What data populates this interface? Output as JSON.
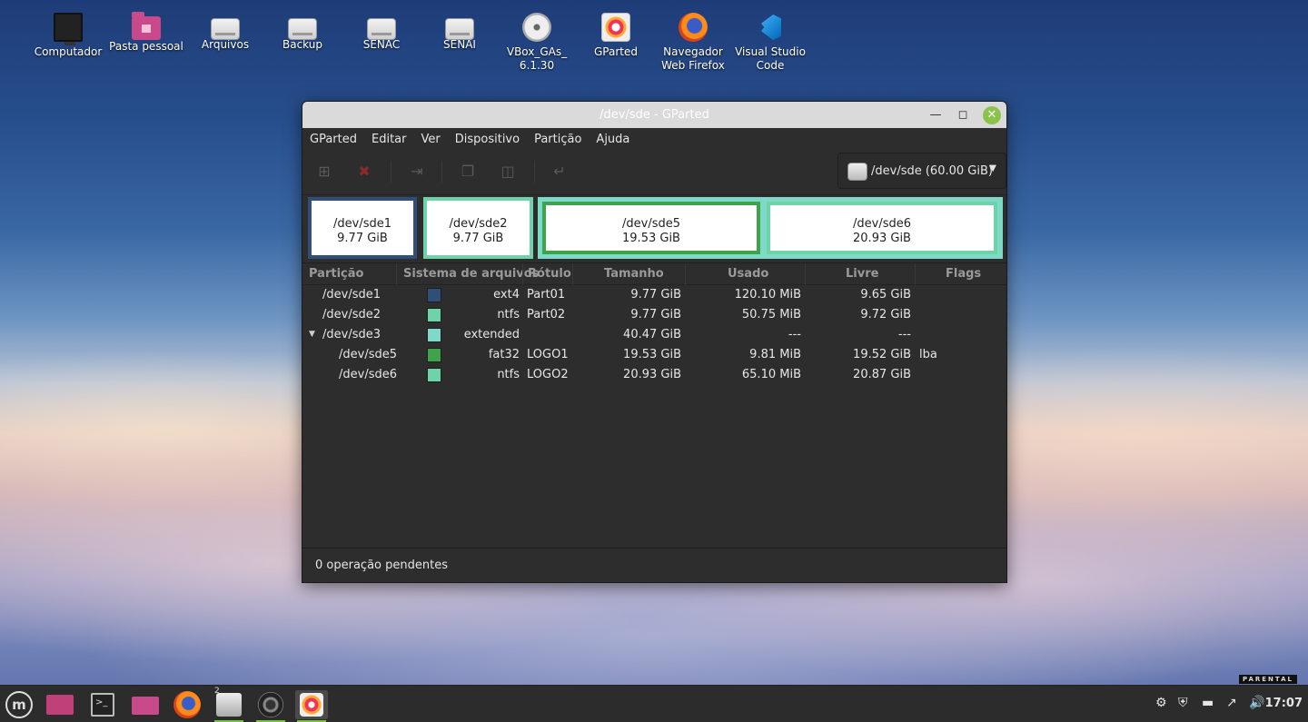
{
  "desktop": {
    "icons": [
      {
        "label": "Computador",
        "icon": "computer-icon"
      },
      {
        "label": "Pasta pessoal",
        "icon": "home-folder-icon"
      },
      {
        "label": "Arquivos",
        "icon": "drive-icon"
      },
      {
        "label": "Backup",
        "icon": "drive-icon"
      },
      {
        "label": "SENAC",
        "icon": "drive-icon"
      },
      {
        "label": "SENAI",
        "icon": "drive-icon"
      },
      {
        "label": "VBox_GAs_ 6.1.30",
        "icon": "disc-icon"
      },
      {
        "label": "GParted",
        "icon": "gparted-icon"
      },
      {
        "label": "Navegador Web Firefox",
        "icon": "firefox-icon"
      },
      {
        "label": "Visual Studio Code",
        "icon": "vscode-icon"
      }
    ]
  },
  "window": {
    "title": "/dev/sde - GParted",
    "menu": [
      "GParted",
      "Editar",
      "Ver",
      "Dispositivo",
      "Partição",
      "Ajuda"
    ],
    "toolbar": {
      "buttons": [
        "new-partition-icon",
        "delete-icon",
        "resize-move-icon",
        "copy-icon",
        "paste-icon",
        "undo-icon"
      ]
    },
    "device": {
      "label": "/dev/sde (60.00 GiB)"
    },
    "partition_map": [
      {
        "name": "/dev/sde1",
        "size": "9.77 GiB",
        "color": "#2f4f78"
      },
      {
        "name": "/dev/sde2",
        "size": "9.77 GiB",
        "color": "#6ed3a8"
      },
      {
        "name": "/dev/sde5",
        "size": "19.53 GiB",
        "color": "#3ea34a"
      },
      {
        "name": "/dev/sde6",
        "size": "20.93 GiB",
        "color": "#6ed3a8"
      }
    ],
    "extended_color": "#7fd9c7",
    "columns": [
      "Partição",
      "Sistema de arquivos",
      "Rótulo",
      "Tamanho",
      "Usado",
      "Livre",
      "Flags"
    ],
    "rows": [
      {
        "partition": "/dev/sde1",
        "color": "#2f4f78",
        "fs": "ext4",
        "label": "Part01",
        "size": "9.77 GiB",
        "used": "120.10 MiB",
        "free": "9.65 GiB",
        "flags": ""
      },
      {
        "partition": "/dev/sde2",
        "color": "#6ed3a8",
        "fs": "ntfs",
        "label": "Part02",
        "size": "9.77 GiB",
        "used": "50.75 MiB",
        "free": "9.72 GiB",
        "flags": ""
      },
      {
        "partition": "/dev/sde3",
        "color": "#7fd9c7",
        "fs": "extended",
        "label": "",
        "size": "40.47 GiB",
        "used": "---",
        "free": "---",
        "flags": ""
      },
      {
        "partition": "/dev/sde5",
        "color": "#3ea34a",
        "fs": "fat32",
        "label": "LOGO1",
        "size": "19.53 GiB",
        "used": "9.81 MiB",
        "free": "19.52 GiB",
        "flags": "lba"
      },
      {
        "partition": "/dev/sde6",
        "color": "#6ed3a8",
        "fs": "ntfs",
        "label": "LOGO2",
        "size": "20.93 GiB",
        "used": "65.10 MiB",
        "free": "20.87 GiB",
        "flags": ""
      }
    ],
    "status": "0 operação pendentes"
  },
  "panel": {
    "menu_icon": "mint-menu-icon",
    "launchers": [
      "show-desktop-icon",
      "terminal-icon",
      "files-icon",
      "firefox-icon",
      "disks-icon",
      "camera-icon",
      "gparted-icon"
    ],
    "disks_badge": "2",
    "clock": "17:07",
    "watermark": "PARENTAL"
  }
}
